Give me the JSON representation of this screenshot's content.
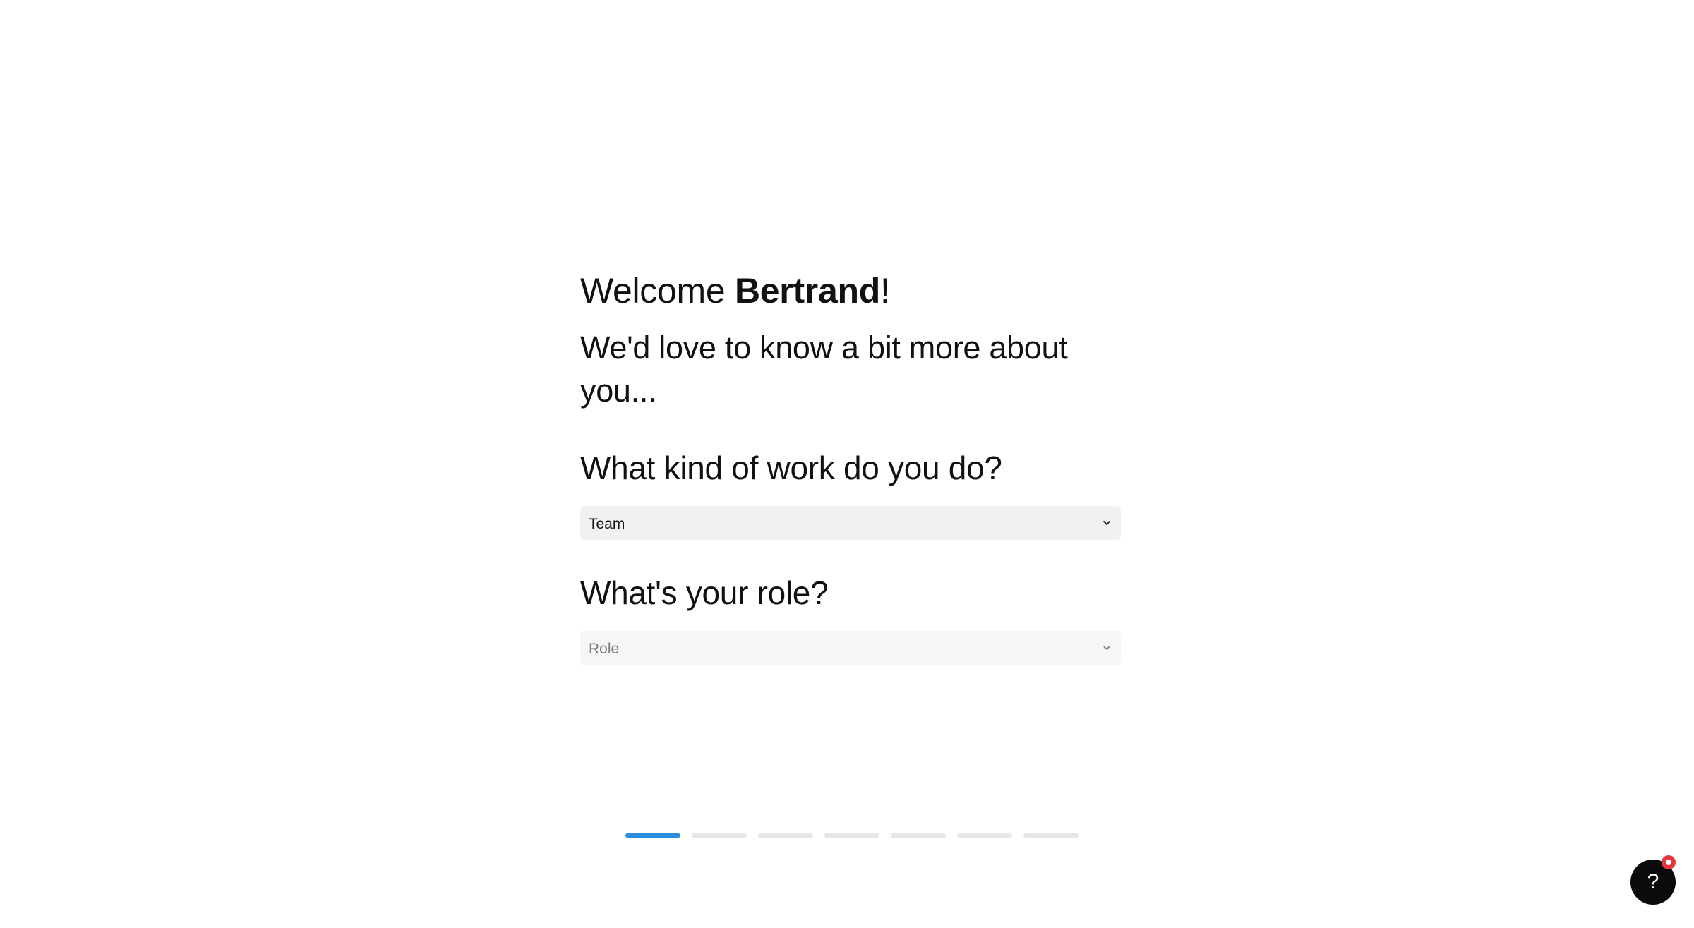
{
  "welcome": {
    "greeting": "Welcome",
    "name": "Bertrand",
    "punctuation": "!"
  },
  "subtitle": "We'd love to know a bit more about you...",
  "work_question": {
    "label": "What kind of work do you do?",
    "selected_value": "Team"
  },
  "role_question": {
    "label": "What's your role?",
    "placeholder": "Role"
  },
  "progress": {
    "total_steps": 7,
    "current_step": 1
  },
  "help": {
    "icon_glyph": "?",
    "icon": "question-mark-icon",
    "badge": "notification-dot"
  },
  "colors": {
    "accent": "#2b8de0",
    "badge": "#e5373b",
    "help_button": "#0b0b0b"
  }
}
